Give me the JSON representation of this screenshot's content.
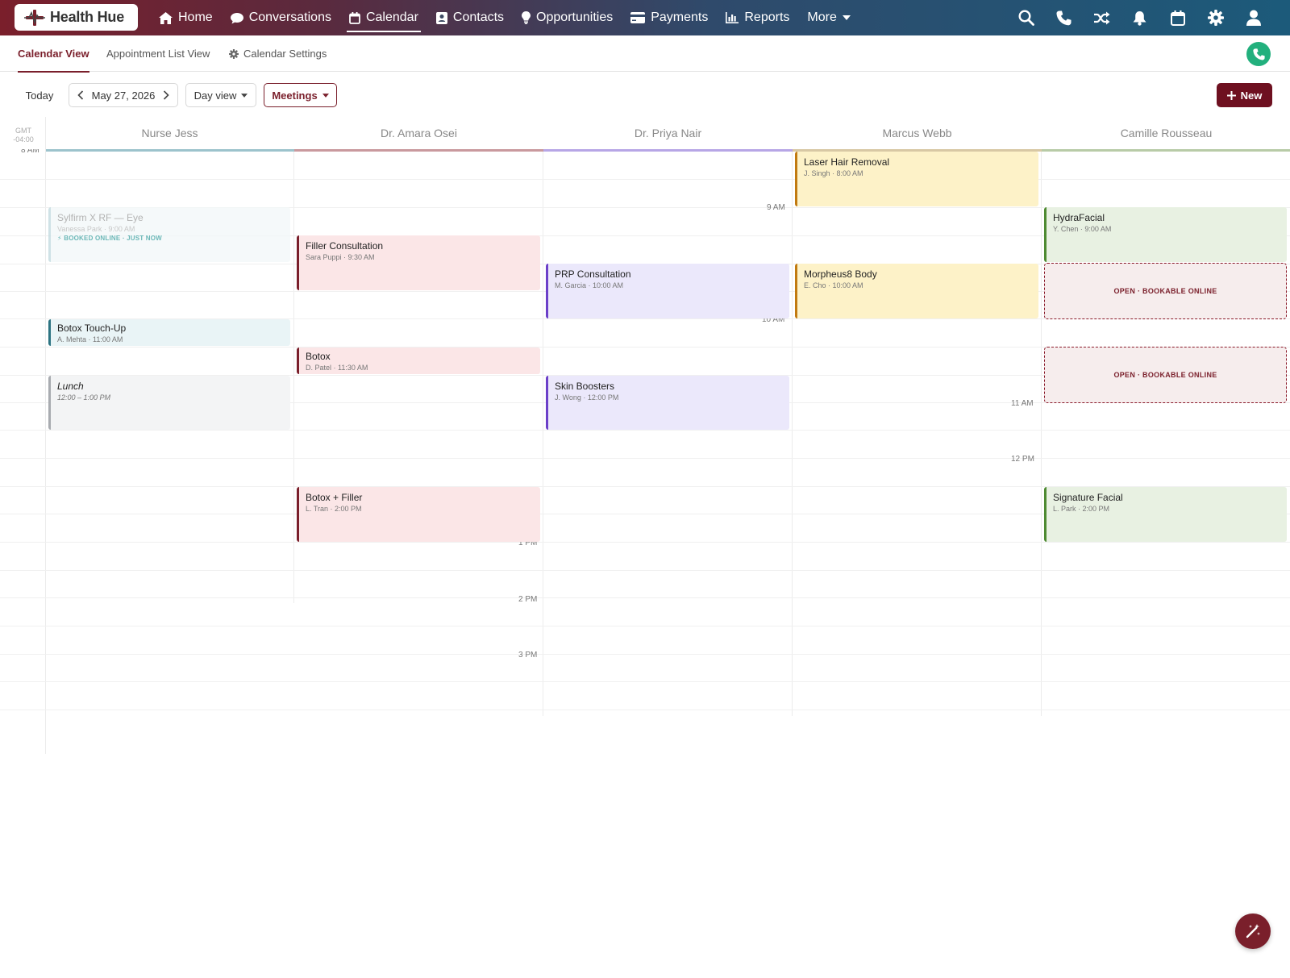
{
  "brand": {
    "name": "Health Hue"
  },
  "nav": {
    "items": [
      {
        "label": "Home",
        "icon": "home-icon"
      },
      {
        "label": "Conversations",
        "icon": "chat-icon"
      },
      {
        "label": "Calendar",
        "icon": "calendar-icon",
        "active": true
      },
      {
        "label": "Contacts",
        "icon": "contact-card-icon"
      },
      {
        "label": "Opportunities",
        "icon": "lightbulb-icon"
      },
      {
        "label": "Payments",
        "icon": "credit-card-icon"
      },
      {
        "label": "Reports",
        "icon": "bar-chart-icon"
      },
      {
        "label": "More",
        "icon": "caret-down-icon"
      }
    ],
    "right_icons": [
      "search-icon",
      "phone-icon",
      "shuffle-icon",
      "bell-icon",
      "calendar-icon",
      "gear-icon",
      "user-icon"
    ]
  },
  "subtabs": {
    "calendar_view": "Calendar View",
    "appointment_list_view": "Appointment List View",
    "calendar_settings": "Calendar Settings"
  },
  "toolbar": {
    "today": "Today",
    "date": "May 27, 2026",
    "view": "Day view",
    "filter": "Meetings",
    "new": "New"
  },
  "calendar": {
    "timezone_line1": "GMT",
    "timezone_line2": "-04:00",
    "first_hour": "8 AM",
    "columns": [
      {
        "name": "Nurse Jess",
        "color": "#9cc3cc"
      },
      {
        "name": "Dr. Amara Osei",
        "color": "#c9999e"
      },
      {
        "name": "Dr. Priya Nair",
        "color": "#b7a6e6"
      },
      {
        "name": "Marcus Webb",
        "color": "#d8c8a4"
      },
      {
        "name": "Camille Rousseau",
        "color": "#b8cba7"
      }
    ],
    "time_labels": [
      "9 AM",
      "10 AM",
      "11 AM",
      "12 PM",
      "1 PM",
      "2 PM",
      "3 PM"
    ],
    "events": {
      "sylfirm": {
        "title": "Sylfirm X RF — Eye",
        "sub": "Vanessa Park · 9:00 AM",
        "badge": "⚡ BOOKED ONLINE · JUST NOW"
      },
      "botox_touchup": {
        "title": "Botox Touch-Up",
        "sub": "A. Mehta · 11:00 AM"
      },
      "lunch": {
        "title": "Lunch",
        "sub": "12:00 – 1:00 PM"
      },
      "filler": {
        "title": "Filler Consultation",
        "sub": "Sara Puppi · 9:30 AM"
      },
      "botox": {
        "title": "Botox",
        "sub": "D. Patel · 11:30 AM"
      },
      "botox_filler": {
        "title": "Botox + Filler",
        "sub": "L. Tran · 2:00 PM"
      },
      "prp": {
        "title": "PRP Consultation",
        "sub": "M. Garcia · 10:00 AM"
      },
      "skin": {
        "title": "Skin Boosters",
        "sub": "J. Wong · 12:00 PM"
      },
      "laser": {
        "title": "Laser Hair Removal",
        "sub": "J. Singh · 8:00 AM"
      },
      "morpheus": {
        "title": "Morpheus8 Body",
        "sub": "E. Cho · 10:00 AM"
      },
      "hydra": {
        "title": "HydraFacial",
        "sub": "Y. Chen · 9:00 AM"
      },
      "signature": {
        "title": "Signature Facial",
        "sub": "L. Park · 2:00 PM"
      },
      "open_slot": "OPEN · BOOKABLE ONLINE"
    }
  },
  "colors": {
    "brand": "#7a1f2b",
    "teal_event": "#e9f4f6",
    "pink_event": "#fbe6e7",
    "purple_event": "#ebe8fb",
    "yellow_event": "#fdf2c8",
    "green_event": "#e8f1e2",
    "call_green": "#22b07d"
  }
}
